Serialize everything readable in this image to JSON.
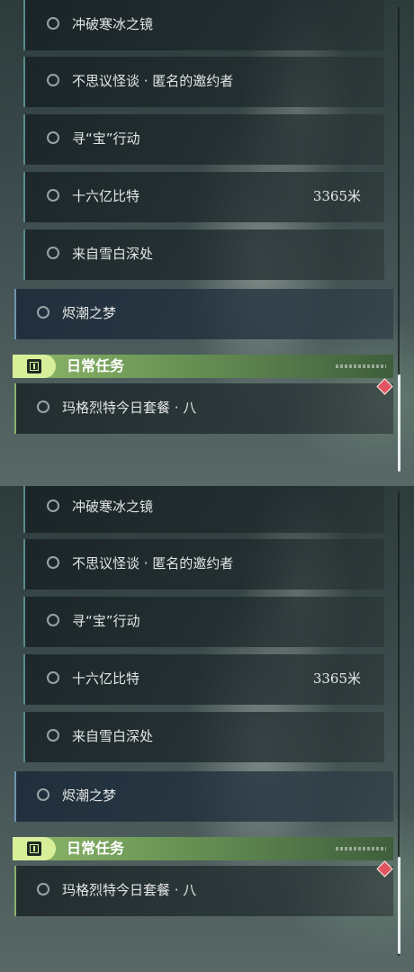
{
  "quests": [
    {
      "label": "冲破寒冰之镜",
      "distance": ""
    },
    {
      "label": "不思议怪谈 · 匿名的邀约者",
      "distance": ""
    },
    {
      "label": "寻“宝”行动",
      "distance": ""
    },
    {
      "label": "十六亿比特",
      "distance": "3365米"
    },
    {
      "label": "来自雪白深处",
      "distance": ""
    }
  ],
  "active_quest": {
    "label": "烬潮之梦"
  },
  "daily_section": {
    "title": "日常任务"
  },
  "daily_quest": {
    "label": "玛格烈特今日套餐 · 八"
  },
  "icons": {
    "quest_status": "circle-icon",
    "daily_header": "alert-box-icon",
    "tracking_marker": "diamond-marker-icon"
  },
  "colors": {
    "daily_accent": "#d8ef9a",
    "marker": "#e05560",
    "active_border": "#6f93b0"
  }
}
